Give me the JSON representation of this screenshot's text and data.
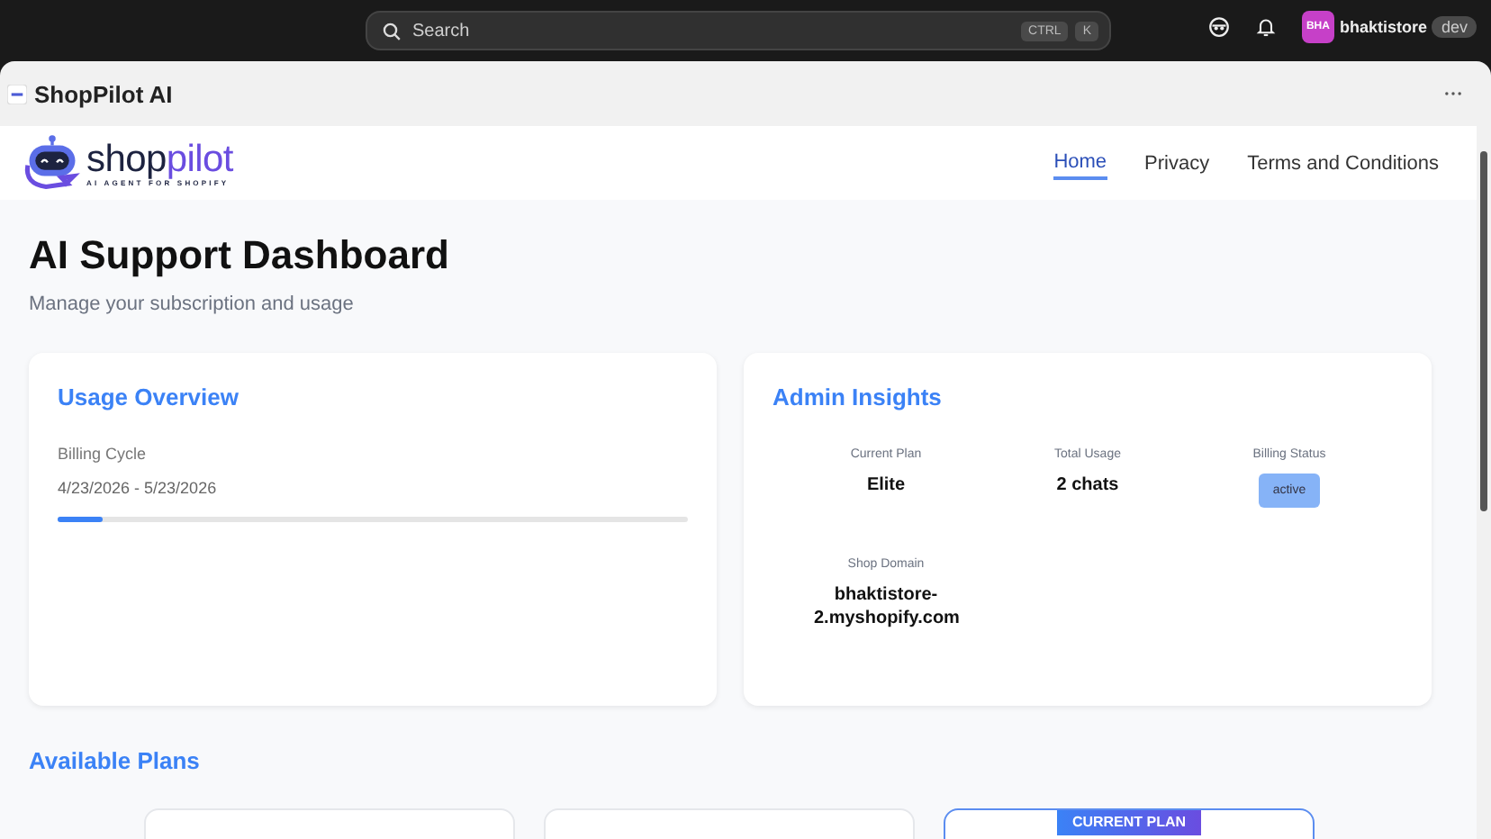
{
  "topbar": {
    "search": {
      "placeholder": "Search"
    },
    "shortcut_keys": [
      "CTRL",
      "K"
    ],
    "user": {
      "initials": "BHA",
      "name": "bhaktistore",
      "badge": "dev"
    }
  },
  "app": {
    "title": "ShopPilot AI"
  },
  "nav": {
    "logo": {
      "word_1": "shop",
      "word_2": "pilot",
      "tagline": "AI AGENT FOR SHOPIFY"
    },
    "links": [
      {
        "label": "Home",
        "selected": true
      },
      {
        "label": "Privacy",
        "selected": false
      },
      {
        "label": "Terms and Conditions",
        "selected": false
      }
    ]
  },
  "page": {
    "title": "AI Support Dashboard",
    "subtitle": "Manage your subscription and usage"
  },
  "usage_overview": {
    "title": "Usage Overview",
    "label": "Billing Cycle",
    "dates": "4/23/2026 - 5/23/2026",
    "level": 0.07
  },
  "admin_insights": {
    "title": "Admin Insights",
    "stats": [
      {
        "label": "Current Plan",
        "value": "Elite",
        "kind": "text"
      },
      {
        "label": "Total Usage",
        "value": "2 chats",
        "kind": "text"
      },
      {
        "label": "Billing Status",
        "value": "active",
        "kind": "badge"
      },
      {
        "label": "Shop Domain",
        "value": "bhaktistore-2.myshopify.com",
        "kind": "text"
      }
    ]
  },
  "plans": {
    "title": "Available Plans",
    "cards": [
      {
        "current": false
      },
      {
        "current": false
      },
      {
        "current": true,
        "badge": "CURRENT PLAN"
      }
    ]
  }
}
